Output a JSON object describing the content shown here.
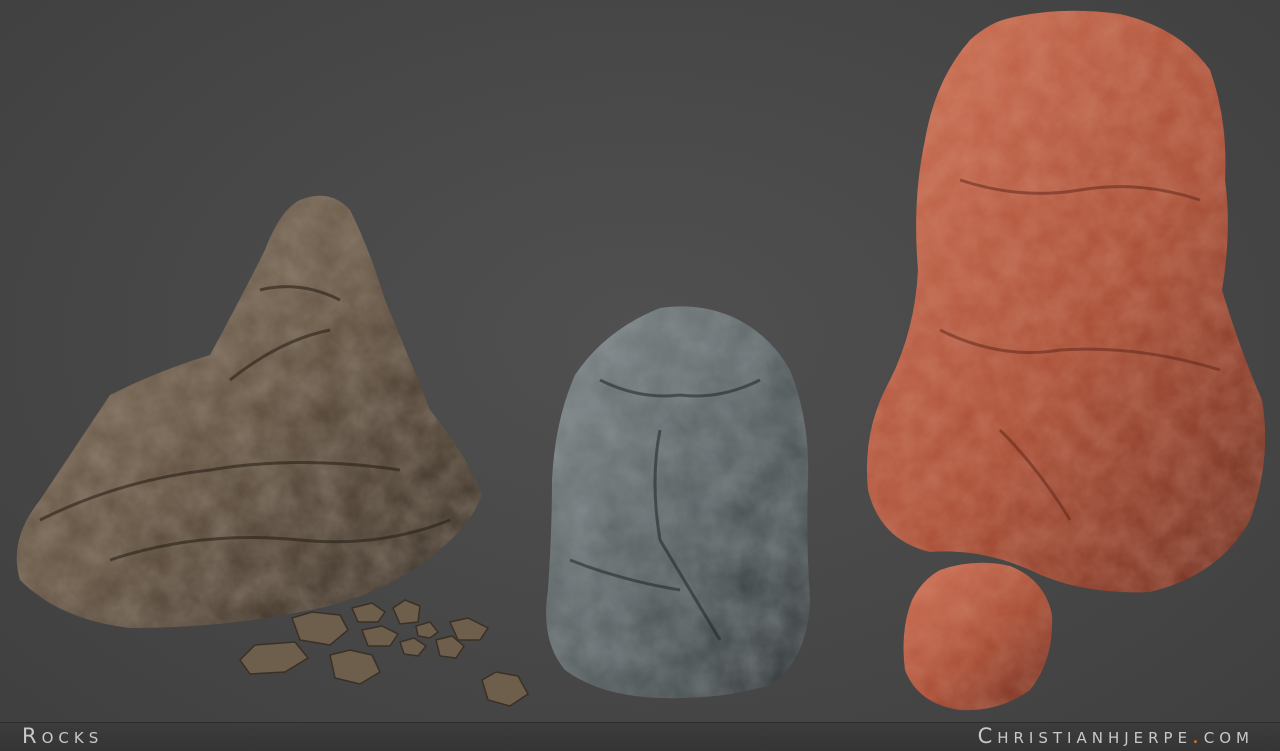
{
  "caption": {
    "left_label": "Rocks",
    "site_name": "Christianhjerpe",
    "site_dot": ".",
    "site_tld": "com"
  },
  "colors": {
    "background": "#4a4a4a",
    "caption_bar": "#383838",
    "caption_text": "#c9c9c9",
    "accent_dot": "#e07a2a",
    "brown_rock": "#6b5a48",
    "grey_rock": "#5e6668",
    "red_rock": "#b5543a"
  }
}
